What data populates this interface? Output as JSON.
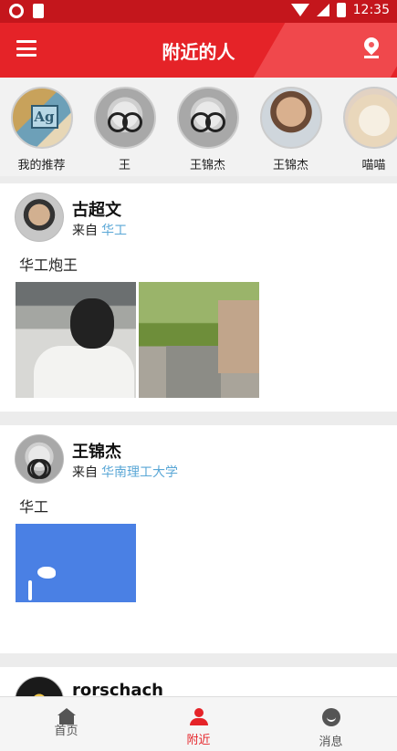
{
  "status_bar": {
    "time": "12:35"
  },
  "app_bar": {
    "title": "附近的人"
  },
  "recommended": [
    {
      "label": "我的推荐",
      "style": "face-ag",
      "tag": "Ag"
    },
    {
      "label": "王",
      "style": "face-bw"
    },
    {
      "label": "王锦杰",
      "style": "face-bw"
    },
    {
      "label": "王锦杰",
      "style": "face-man"
    },
    {
      "label": "喵喵",
      "style": "face-cat"
    }
  ],
  "posts": [
    {
      "name": "古超文",
      "from_prefix": "来自",
      "school": "华工",
      "text": "华工炮王"
    },
    {
      "name": "王锦杰",
      "from_prefix": "来自",
      "school": "华南理工大学",
      "text": "华工"
    },
    {
      "name": "rorschach"
    }
  ],
  "tabs": [
    {
      "label": "首页",
      "icon": "home-icon"
    },
    {
      "label": "附近",
      "icon": "person-icon",
      "active": true
    },
    {
      "label": "消息",
      "icon": "chat-icon"
    }
  ]
}
